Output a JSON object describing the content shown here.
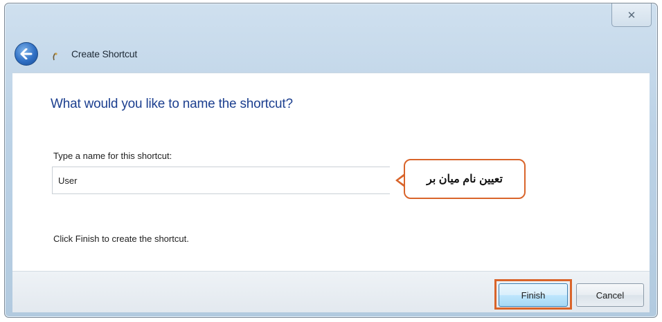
{
  "window": {
    "title": "Create Shortcut",
    "close_glyph": "✕"
  },
  "icons": {
    "back": "back-arrow-icon",
    "wizard": "shortcut-wizard-icon",
    "close": "close-icon"
  },
  "page": {
    "heading": "What would you like to name the shortcut?",
    "field_label": "Type a name for this shortcut:",
    "name_value": "User",
    "callout_text": "تعیین نام میان بر",
    "instruction": "Click Finish to create the shortcut."
  },
  "footer": {
    "finish_label": "Finish",
    "cancel_label": "Cancel"
  },
  "colors": {
    "heading": "#1c3f8f",
    "highlight": "#d9642a",
    "titlebar": "#bcd2e6"
  }
}
